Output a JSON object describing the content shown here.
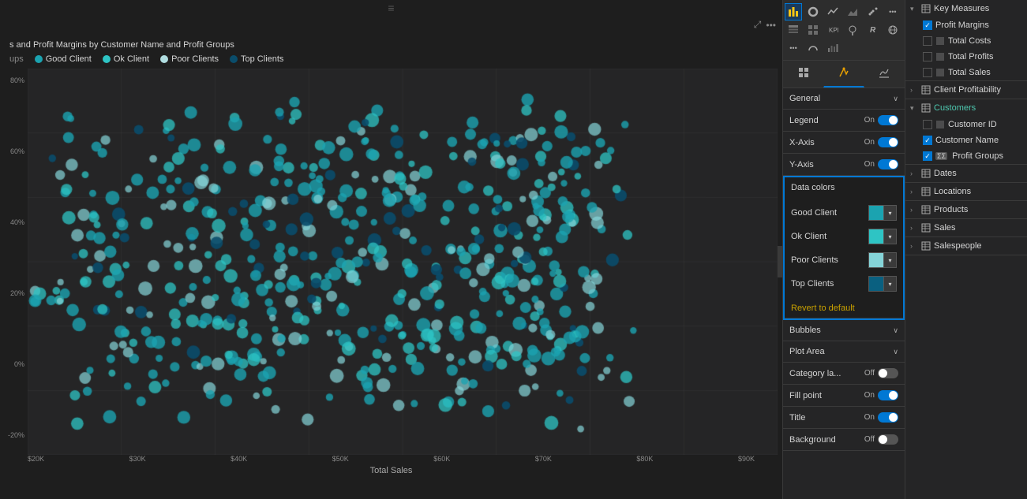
{
  "chart": {
    "title": "s and Profit Margins by Customer Name and Profit Groups",
    "legend": {
      "groups_label": "ups",
      "items": [
        {
          "label": "Good Client",
          "color": "#1ba3b0"
        },
        {
          "label": "Ok Client",
          "color": "#2ec4c4"
        },
        {
          "label": "Poor Clients",
          "color": "#85d4d8"
        },
        {
          "label": "Top Clients",
          "color": "#0a4d6b"
        }
      ]
    },
    "x_label": "Total Sales",
    "x_ticks": [
      "$20K",
      "$30K",
      "$40K",
      "$50K",
      "$60K",
      "$70K",
      "$80K",
      "$90K"
    ],
    "drag_handle": "≡"
  },
  "format_panel": {
    "tabs": [
      {
        "label": "fields-tab",
        "icon": "fields"
      },
      {
        "label": "format-tab",
        "icon": "format"
      },
      {
        "label": "analytics-tab",
        "icon": "analytics"
      }
    ],
    "sections": [
      {
        "key": "general",
        "label": "General",
        "expanded": false
      },
      {
        "key": "legend",
        "label": "Legend",
        "toggle": "On",
        "toggle_on": true
      },
      {
        "key": "x_axis",
        "label": "X-Axis",
        "toggle": "On",
        "toggle_on": true
      },
      {
        "key": "y_axis",
        "label": "Y-Axis",
        "toggle": "On",
        "toggle_on": true
      }
    ],
    "data_colors": {
      "header": "Data colors",
      "items": [
        {
          "label": "Good Client",
          "color": "#1ba3b0"
        },
        {
          "label": "Ok Client",
          "color": "#2ec4c4"
        },
        {
          "label": "Poor Clients",
          "color": "#85d4d8"
        },
        {
          "label": "Top Clients",
          "color": "#0a6080"
        }
      ],
      "revert_label": "Revert to default"
    },
    "sections_after": [
      {
        "key": "bubbles",
        "label": "Bubbles"
      },
      {
        "key": "plot_area",
        "label": "Plot Area"
      },
      {
        "key": "category_labels",
        "label": "Category la...",
        "toggle": "Off",
        "toggle_on": false
      },
      {
        "key": "fill_point",
        "label": "Fill point",
        "toggle": "On",
        "toggle_on": true
      },
      {
        "key": "title",
        "label": "Title",
        "toggle": "On",
        "toggle_on": true
      },
      {
        "key": "background",
        "label": "Background",
        "toggle": "Off",
        "toggle_on": false
      }
    ]
  },
  "fields_panel": {
    "header": "Key Measures",
    "groups": [
      {
        "label": "Key Measures",
        "expanded": true,
        "icon": "table",
        "items": [
          {
            "label": "Profit Margins",
            "checked": true
          },
          {
            "label": "Total Costs",
            "checked": false
          },
          {
            "label": "Total Profits",
            "checked": false
          },
          {
            "label": "Total Sales",
            "checked": false
          }
        ]
      },
      {
        "label": "Client Profitability",
        "expanded": false,
        "icon": "table"
      },
      {
        "label": "Customers",
        "expanded": true,
        "icon": "table",
        "items": [
          {
            "label": "Customer ID",
            "checked": false
          },
          {
            "label": "Customer Name",
            "checked": true
          },
          {
            "label": "Profit Groups",
            "checked": true,
            "special": true
          }
        ]
      },
      {
        "label": "Dates",
        "expanded": false,
        "icon": "table"
      },
      {
        "label": "Locations",
        "expanded": false,
        "icon": "table"
      },
      {
        "label": "Products",
        "expanded": false,
        "icon": "table"
      },
      {
        "label": "Sales",
        "expanded": false,
        "icon": "table"
      },
      {
        "label": "Salespeople",
        "expanded": false,
        "icon": "table"
      }
    ]
  }
}
